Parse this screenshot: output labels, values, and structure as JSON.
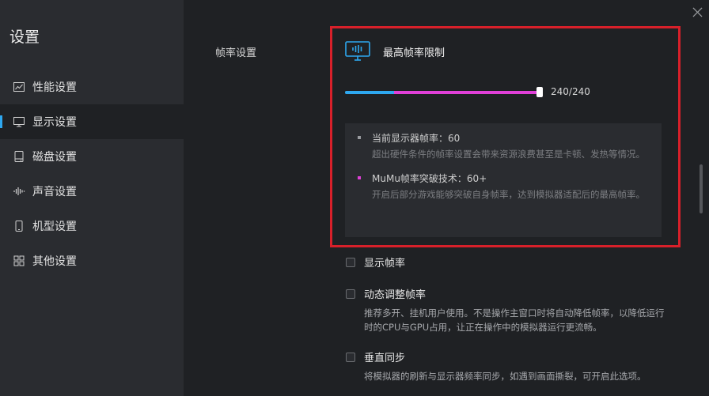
{
  "sidebar": {
    "title": "设置",
    "items": [
      {
        "label": "性能设置",
        "icon": "chart-line-icon"
      },
      {
        "label": "显示设置",
        "icon": "monitor-icon",
        "active": true
      },
      {
        "label": "磁盘设置",
        "icon": "disk-icon"
      },
      {
        "label": "声音设置",
        "icon": "sound-wave-icon"
      },
      {
        "label": "机型设置",
        "icon": "phone-icon"
      },
      {
        "label": "其他设置",
        "icon": "grid-icon"
      }
    ]
  },
  "main": {
    "section_label": "帧率设置",
    "fps_limit": {
      "label": "最高帧率限制",
      "value_text": "240/240",
      "value": 240,
      "max": 240,
      "normal_threshold": 60
    },
    "info": [
      {
        "title": "当前显示器帧率：60",
        "desc": "超出硬件条件的帧率设置会带来资源浪费甚至是卡顿、发热等情况。",
        "bullet_color": "#9a9ca0"
      },
      {
        "title": "MuMu帧率突破技术：60+",
        "desc": "开启后部分游戏能够突破自身帧率，达到模拟器适配后的最高帧率。",
        "bullet_color": "#e040d8"
      }
    ],
    "options": [
      {
        "label": "显示帧率",
        "desc": ""
      },
      {
        "label": "动态调整帧率",
        "desc": "推荐多开、挂机用户使用。不是操作主窗口时将自动降低帧率，以降低运行时的CPU与GPU占用，让正在操作中的模拟器运行更流畅。"
      },
      {
        "label": "垂直同步",
        "desc": "将模拟器的刷新与显示器频率同步，如遇到画面撕裂，可开启此选项。"
      }
    ]
  },
  "colors": {
    "accent_blue": "#2ea8f0",
    "accent_pink": "#e040d8",
    "highlight_red": "#d8202a"
  }
}
